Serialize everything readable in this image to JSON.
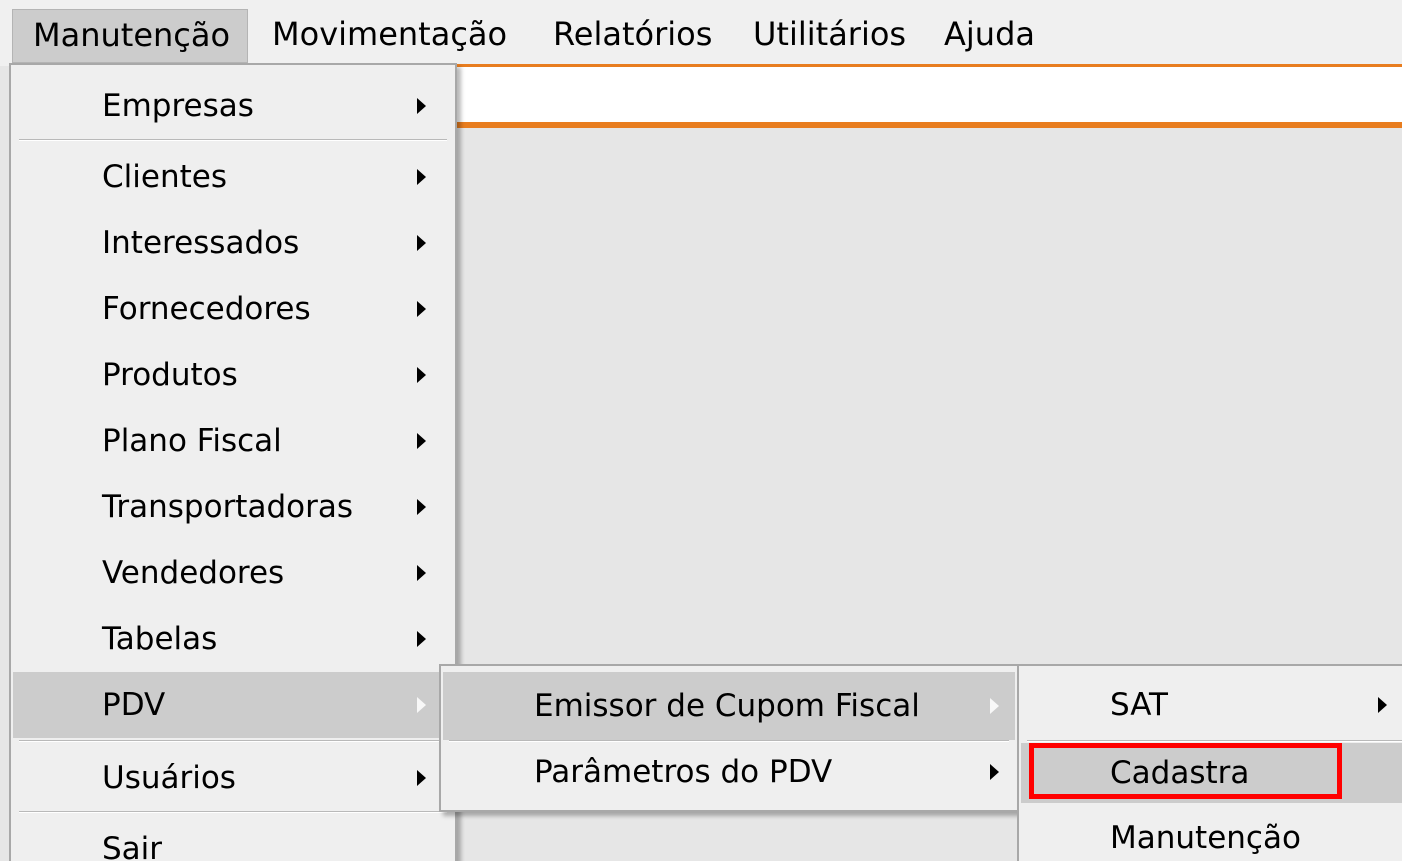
{
  "menubar": {
    "items": [
      {
        "label": "Manutenção"
      },
      {
        "label": "Movimentação"
      },
      {
        "label": "Relatórios"
      },
      {
        "label": "Utilitários"
      },
      {
        "label": "Ajuda"
      }
    ]
  },
  "menu_manutencao": {
    "items": [
      {
        "label": "Empresas",
        "has_submenu": true
      },
      {
        "label": "Clientes",
        "has_submenu": true
      },
      {
        "label": "Interessados",
        "has_submenu": true
      },
      {
        "label": "Fornecedores",
        "has_submenu": true
      },
      {
        "label": "Produtos",
        "has_submenu": true
      },
      {
        "label": "Plano Fiscal",
        "has_submenu": true
      },
      {
        "label": "Transportadoras",
        "has_submenu": true
      },
      {
        "label": "Vendedores",
        "has_submenu": true
      },
      {
        "label": "Tabelas",
        "has_submenu": true
      },
      {
        "label": "PDV",
        "has_submenu": true,
        "highlighted": true
      },
      {
        "label": "Usuários",
        "has_submenu": true
      },
      {
        "label": "Sair",
        "has_submenu": false
      }
    ]
  },
  "menu_pdv": {
    "items": [
      {
        "label": "Emissor de Cupom Fiscal",
        "has_submenu": true,
        "highlighted": true
      },
      {
        "label": "Parâmetros do PDV",
        "has_submenu": true
      }
    ]
  },
  "menu_ecf": {
    "items": [
      {
        "label": "SAT",
        "has_submenu": true
      },
      {
        "label": "Cadastra",
        "has_submenu": false,
        "highlighted": true,
        "annotated": true
      },
      {
        "label": "Manutenção",
        "has_submenu": false
      }
    ]
  },
  "colors": {
    "accent_orange": "#e87d1f",
    "annotation_red": "#ff0000",
    "highlight_gray": "#cccccc",
    "menu_background": "#efefef"
  }
}
